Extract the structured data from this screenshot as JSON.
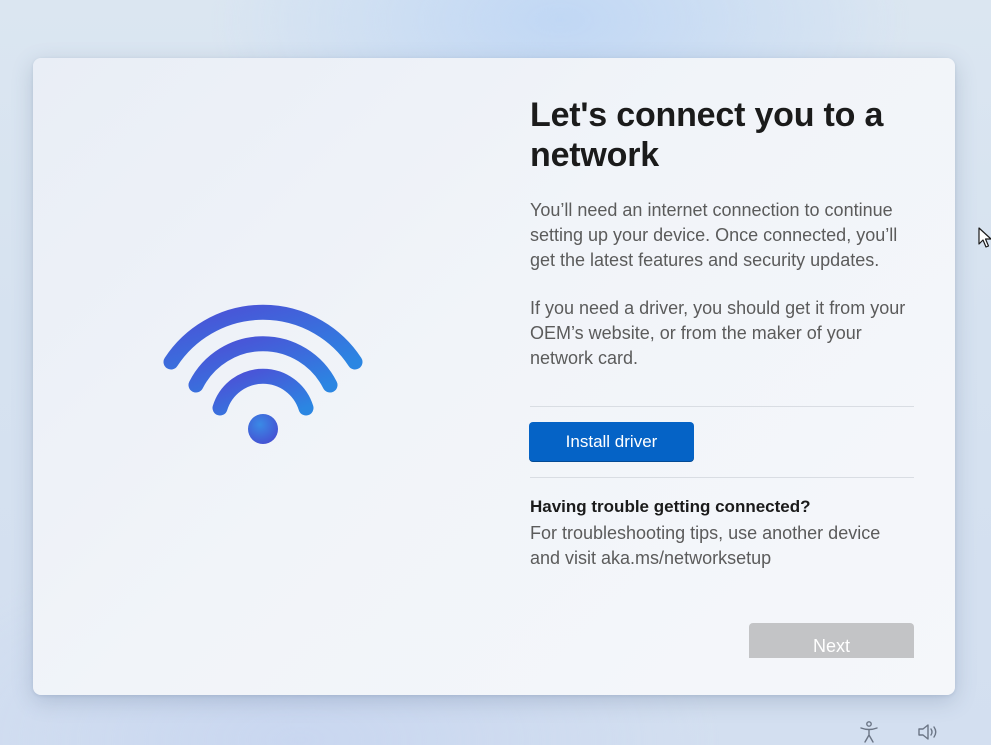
{
  "setup": {
    "title": "Let's connect you to a network",
    "description": "You’ll need an internet connection to continue setting up your device. Once connected, you’ll get the latest features and security updates.",
    "driver_note": "If you need a driver, you should get it from your OEM’s website, or from the maker of your network card.",
    "install_driver_label": "Install driver",
    "trouble_heading": "Having trouble getting connected?",
    "trouble_text": "For troubleshooting tips, use another device and visit aka.ms/networksetup",
    "next_label": "Next"
  },
  "illustration": {
    "icon": "wifi-icon",
    "gradient_start": "#4a53d9",
    "gradient_end": "#2b7de0"
  },
  "colors": {
    "primary_button": "#0563c6",
    "disabled_button": "#c3c4c6"
  },
  "taskbar": {
    "icons": [
      "accessibility-icon",
      "volume-icon"
    ]
  }
}
